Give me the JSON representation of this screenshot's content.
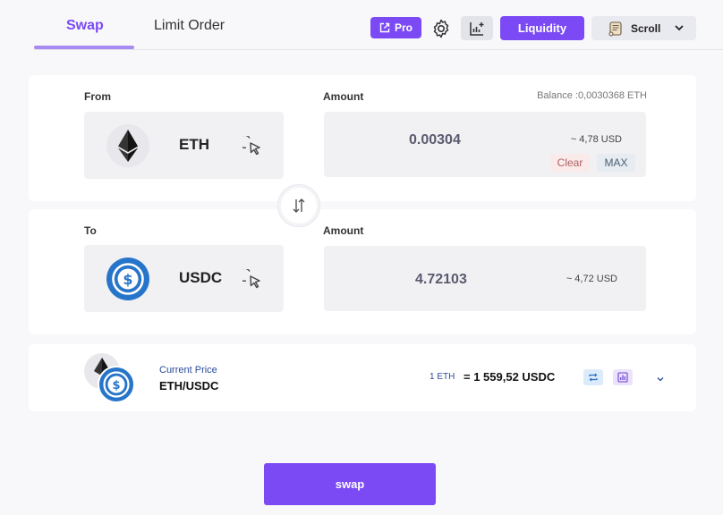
{
  "nav": {
    "tabs": [
      {
        "label": "Swap",
        "active": true
      },
      {
        "label": "Limit Order",
        "active": false
      }
    ],
    "pro_label": "Pro",
    "liquidity_label": "Liquidity",
    "network_label": "Scroll"
  },
  "from": {
    "label": "From",
    "amount_label": "Amount",
    "balance": "Balance :0,0030368 ETH",
    "token": "ETH",
    "amount": "0.00304",
    "usd": "~ 4,78 USD",
    "clear_label": "Clear",
    "max_label": "MAX"
  },
  "to": {
    "label": "To",
    "amount_label": "Amount",
    "token": "USDC",
    "amount": "4.72103",
    "usd": "~ 4,72 USD"
  },
  "price": {
    "caption": "Current Price",
    "pair": "ETH/USDC",
    "rate_left": "1 ETH",
    "rate_right": "= 1 559,52 USDC"
  },
  "action": {
    "swap_label": "swap"
  },
  "colors": {
    "accent": "#7b4af5",
    "usdc": "#2775ca",
    "eth": "#3c3c3d"
  }
}
